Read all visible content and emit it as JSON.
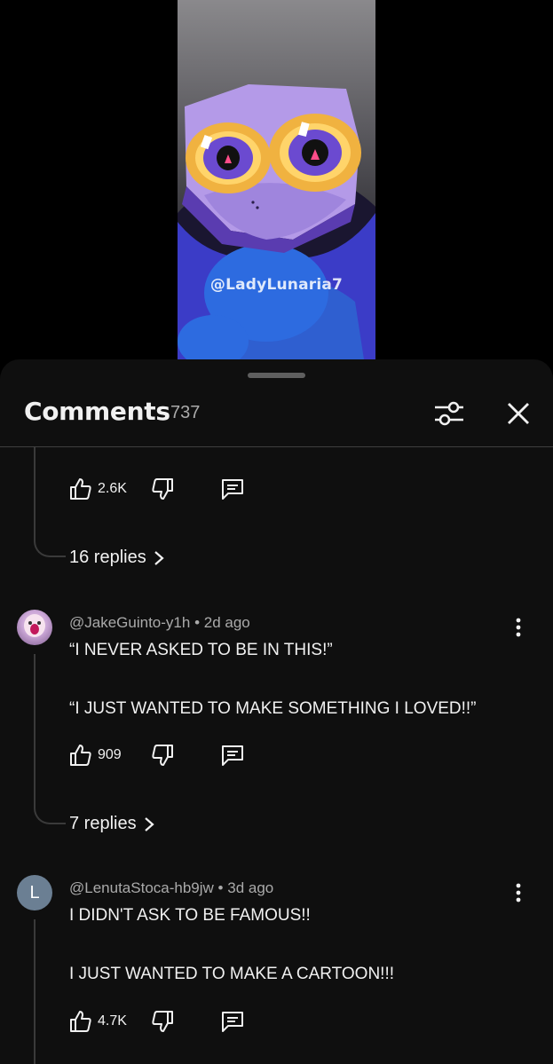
{
  "video": {
    "watermark": "@LadyLunaria7"
  },
  "comments_panel": {
    "title": "Comments",
    "count": "737"
  },
  "thread_top": {
    "partial_text": "... ...",
    "likes": "2.6K",
    "replies_label": "16 replies"
  },
  "comments": [
    {
      "handle": "@JakeGuinto-y1h",
      "time": "2d ago",
      "lines": [
        "“I NEVER ASKED TO BE IN THIS!”",
        "“I JUST WANTED TO MAKE SOMETHING I LOVED!!”"
      ],
      "likes": "909",
      "replies_label": "7 replies"
    },
    {
      "handle": "@LenutaStoca-hb9jw",
      "time": "3d ago",
      "avatar_letter": "L",
      "lines": [
        "I DIDN'T ASK TO BE FAMOUS!!",
        "I JUST WANTED TO MAKE A CARTOON!!!"
      ],
      "likes": "4.7K"
    }
  ],
  "colors": {
    "sheet_bg": "#0f0f0f",
    "secondary_text": "#aaaaaa",
    "thread_line": "#3a3a3a"
  }
}
